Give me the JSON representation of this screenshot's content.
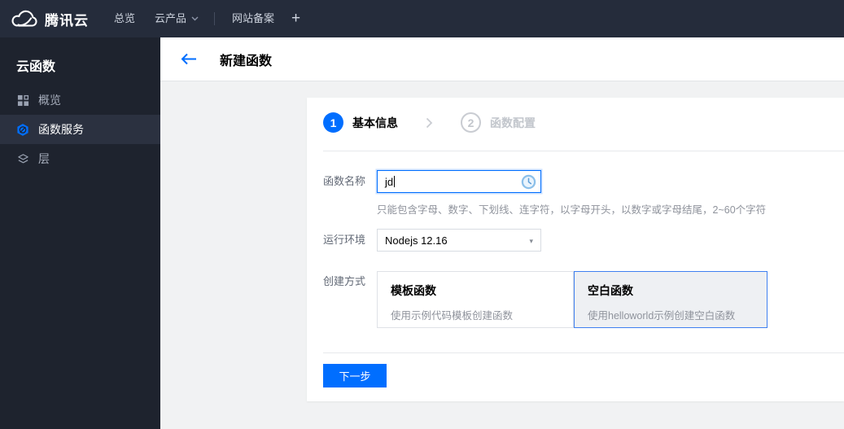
{
  "topbar": {
    "brand": "腾讯云",
    "nav": [
      {
        "label": "总览"
      },
      {
        "label": "云产品",
        "has_caret": true
      },
      {
        "label": "网站备案"
      }
    ],
    "plus_label": "+"
  },
  "sidebar": {
    "title": "云函数",
    "items": [
      {
        "label": "概览",
        "icon": "grid-icon",
        "active": false
      },
      {
        "label": "函数服务",
        "icon": "scf-hexagon-icon",
        "active": true
      },
      {
        "label": "层",
        "icon": "layers-icon",
        "active": false
      }
    ]
  },
  "header": {
    "title": "新建函数",
    "back_icon": "back-arrow-icon"
  },
  "wizard": {
    "steps": [
      {
        "num": "1",
        "label": "基本信息",
        "active": true
      },
      {
        "num": "2",
        "label": "函数配置",
        "active": false
      }
    ],
    "form": {
      "name": {
        "label": "函数名称",
        "value": "jd",
        "helper": "只能包含字母、数字、下划线、连字符，以字母开头，以数字或字母结尾，2~60个字符",
        "trailing_icon": "history-clock-icon"
      },
      "runtime": {
        "label": "运行环境",
        "value": "Nodejs 12.16",
        "caret": "▾"
      },
      "method": {
        "label": "创建方式",
        "options": [
          {
            "title": "模板函数",
            "desc": "使用示例代码模板创建函数",
            "selected": false
          },
          {
            "title": "空白函数",
            "desc": "使用helloworld示例创建空白函数",
            "selected": true
          }
        ]
      }
    },
    "next_button": "下一步"
  },
  "colors": {
    "accent_blue": "#006eff",
    "topbar_bg": "#252c3b",
    "sidebar_bg": "#1e232e",
    "sidebar_active_bg": "#2b3140",
    "content_bg": "#f1f2f3",
    "selected_card_border": "#3f80f1",
    "muted_text": "#8f939c",
    "inactive_step": "#c2c6cc"
  }
}
